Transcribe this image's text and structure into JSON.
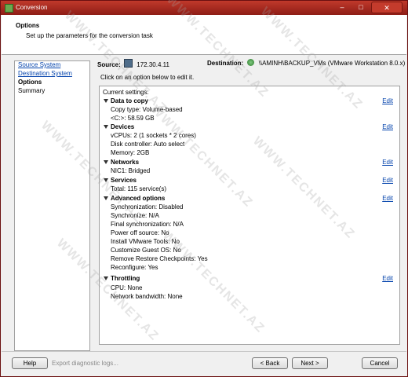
{
  "window": {
    "title": "Conversion",
    "minimize": "–",
    "maximize": "□",
    "close": "✕"
  },
  "header": {
    "title": "Options",
    "subtitle": "Set up the parameters for the conversion task"
  },
  "nav": {
    "items": [
      {
        "label": "Source System"
      },
      {
        "label": "Destination System"
      },
      {
        "label": "Options"
      },
      {
        "label": "Summary"
      }
    ]
  },
  "source": {
    "label": "Source:",
    "value": "172.30.4.11",
    "icon": "server-icon"
  },
  "destination": {
    "label": "Destination:",
    "value": "\\\\AMINH\\BACKUP_VMs (VMware Workstation 8.0.x)",
    "icon": "vm-icon"
  },
  "hint": "Click on an option below to edit it.",
  "settings": {
    "header": "Current settings:",
    "edit_label": "Edit",
    "sections": [
      {
        "title": "Data to copy",
        "items": [
          "Copy type: Volume-based",
          "<C:>: 58.59 GB"
        ]
      },
      {
        "title": "Devices",
        "items": [
          "vCPUs: 2 (1 sockets * 2 cores)",
          "Disk controller: Auto select",
          "Memory: 2GB"
        ]
      },
      {
        "title": "Networks",
        "items": [
          "NIC1: Bridged"
        ]
      },
      {
        "title": "Services",
        "items": [
          "Total: 115 service(s)"
        ]
      },
      {
        "title": "Advanced options",
        "items": [
          "Synchronization: Disabled",
          "Synchronize: N/A",
          "Final synchronization: N/A",
          "Power off source: No",
          "Install VMware Tools: No",
          "Customize Guest OS: No",
          "Remove Restore Checkpoints: Yes",
          "Reconfigure: Yes"
        ]
      },
      {
        "title": "Throttling",
        "items": [
          "CPU: None",
          "Network bandwidth: None"
        ]
      }
    ]
  },
  "footer": {
    "help": "Help",
    "export": "Export diagnostic logs...",
    "back": "< Back",
    "next": "Next >",
    "cancel": "Cancel"
  },
  "watermark": "WWW.TECHNET.AZ"
}
